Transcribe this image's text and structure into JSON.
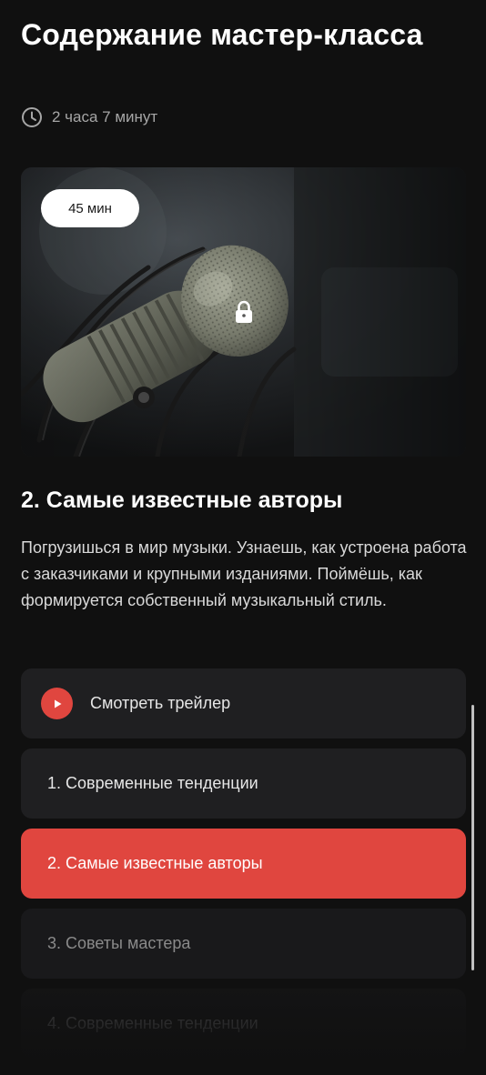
{
  "header": {
    "title": "Содержание мастер-класса",
    "duration": "2 часа 7 минут"
  },
  "video": {
    "badge": "45 мин",
    "image_subject": "studio-microphone",
    "locked": true
  },
  "lesson": {
    "title": "2. Самые известные авторы",
    "description": "Погрузишься в мир музыки. Узнаешь, как устроена работа с заказчиками и крупными изданиями. Поймёшь, как формируется собственный музыкальный стиль."
  },
  "lesson_list": {
    "trailer_label": "Смотреть трейлер",
    "items": [
      {
        "label": "1. Современные тенденции",
        "state": "default"
      },
      {
        "label": "2. Самые известные авторы",
        "state": "active"
      },
      {
        "label": "3. Советы мастера",
        "state": "dim"
      },
      {
        "label": "4. Современные тенденции",
        "state": "faded"
      }
    ]
  },
  "colors": {
    "background": "#101010",
    "accent": "#e0463f",
    "card": "#1f1f21",
    "muted_text": "#a6a6a6"
  },
  "icons": {
    "duration": "clock-icon",
    "lock": "lock-icon",
    "trailer": "play-icon"
  }
}
